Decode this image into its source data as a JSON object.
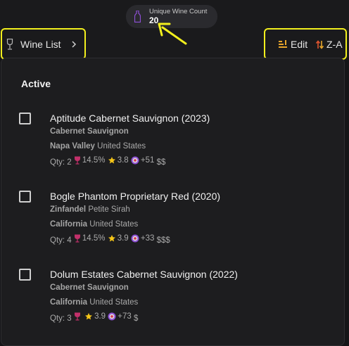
{
  "header": {
    "count_label": "Unique Wine Count",
    "count_value": "20",
    "breadcrumb_label": "Wine List",
    "edit_label": "Edit",
    "sort_label": "Z-A"
  },
  "section": {
    "title": "Active"
  },
  "colors": {
    "highlight": "#f2ef1d",
    "accent_purple": "#8e4fd6",
    "star": "#f5c518",
    "glass": "#c2306a"
  },
  "wines": [
    {
      "name": "Aptitude Cabernet Sauvignon (2023)",
      "varietal": "Cabernet Sauvignon",
      "varietal_extra": "",
      "region": "Napa Valley",
      "country": "United States",
      "qty": "Qty: 2",
      "abv": "14.5%",
      "rating": "3.8",
      "score": "+51",
      "price": "$$"
    },
    {
      "name": "Bogle Phantom Proprietary Red (2020)",
      "varietal": "Zinfandel",
      "varietal_extra": "Petite Sirah",
      "region": "California",
      "country": "United States",
      "qty": "Qty: 4",
      "abv": "14.5%",
      "rating": "3.9",
      "score": "+33",
      "price": "$$$"
    },
    {
      "name": "Dolum Estates Cabernet Sauvignon (2022)",
      "varietal": "Cabernet Sauvignon",
      "varietal_extra": "",
      "region": "California",
      "country": "United States",
      "qty": "Qty: 3",
      "abv": "",
      "rating": "3.9",
      "score": "+73",
      "price": "$"
    }
  ]
}
